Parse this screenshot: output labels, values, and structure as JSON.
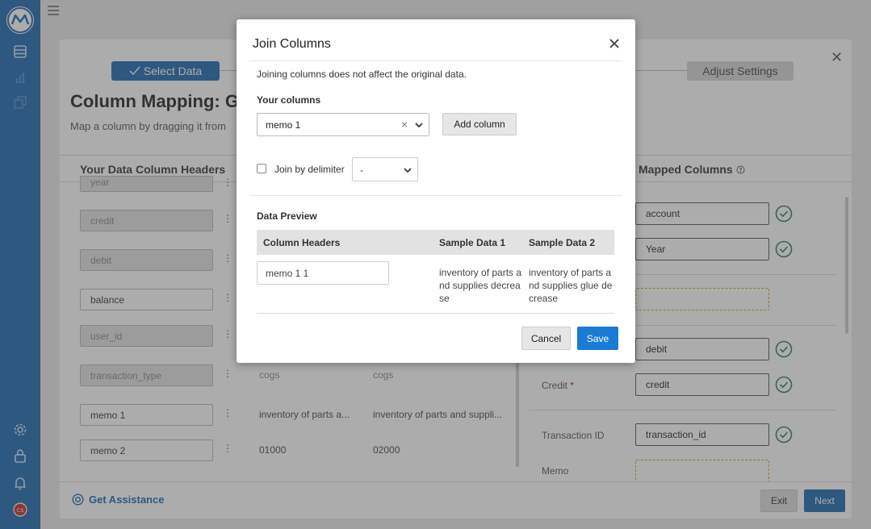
{
  "sidebar": {
    "icons": [
      "logo-icon",
      "database-icon",
      "chart-icon",
      "copy-icon",
      "gear-icon",
      "lock-icon",
      "bell-icon",
      "avatar"
    ],
    "avatar_initials": "CS"
  },
  "wizard": {
    "steps": [
      {
        "label": "Select Data",
        "state": "completed"
      },
      {
        "label": "Adjust Settings",
        "state": "upcoming"
      }
    ],
    "title": "Column Mapping: Go",
    "subtitle": "Map a column by dragging it from",
    "left_header": "Your Data Column Headers",
    "right_header": "Mapped Columns",
    "source_columns": [
      {
        "label": "year",
        "disabled": true
      },
      {
        "label": "credit",
        "disabled": true
      },
      {
        "label": "debit",
        "disabled": true
      },
      {
        "label": "balance",
        "disabled": false
      },
      {
        "label": "user_id",
        "disabled": true
      },
      {
        "label": "transaction_type",
        "disabled": true,
        "sample1": "cogs",
        "sample2": "cogs"
      },
      {
        "label": "memo 1",
        "disabled": false,
        "sample1": "inventory of parts a...",
        "sample2": "inventory of parts and suppli..."
      },
      {
        "label": "memo 2",
        "disabled": false,
        "sample1": "01000",
        "sample2": "02000"
      }
    ],
    "mapped": [
      {
        "label": "",
        "value": "account",
        "ok": true
      },
      {
        "label": "",
        "value": "Year",
        "ok": true
      },
      {
        "label": "",
        "value": "",
        "ok": false
      },
      {
        "label": "",
        "value": "debit",
        "ok": true
      },
      {
        "label": "Credit",
        "required": "*",
        "value": "credit",
        "ok": true
      },
      {
        "label": "Transaction ID",
        "value": "transaction_id",
        "ok": true
      },
      {
        "label": "Memo",
        "value": "",
        "ok": false
      }
    ],
    "footer": {
      "assist": "Get Assistance",
      "exit": "Exit",
      "next": "Next"
    }
  },
  "modal": {
    "title": "Join Columns",
    "description": "Joining columns does not affect the original data.",
    "your_columns_label": "Your columns",
    "selected_column": "memo 1",
    "clear_symbol": "×",
    "add_column": "Add column",
    "join_by_delimiter": "Join by delimiter",
    "delimiter_value": "-",
    "data_preview_label": "Data Preview",
    "table_headers": [
      "Column Headers",
      "Sample Data 1",
      "Sample Data 2"
    ],
    "row": {
      "header_value": "memo 1 1",
      "sample1": "inventory of parts and supplies decrease",
      "sample2": "inventory of parts and supplies glue decrease"
    },
    "cancel": "Cancel",
    "save": "Save"
  },
  "colors": {
    "brand": "#1a67b0",
    "success": "#2e7d4f",
    "warning": "#d4a017"
  }
}
